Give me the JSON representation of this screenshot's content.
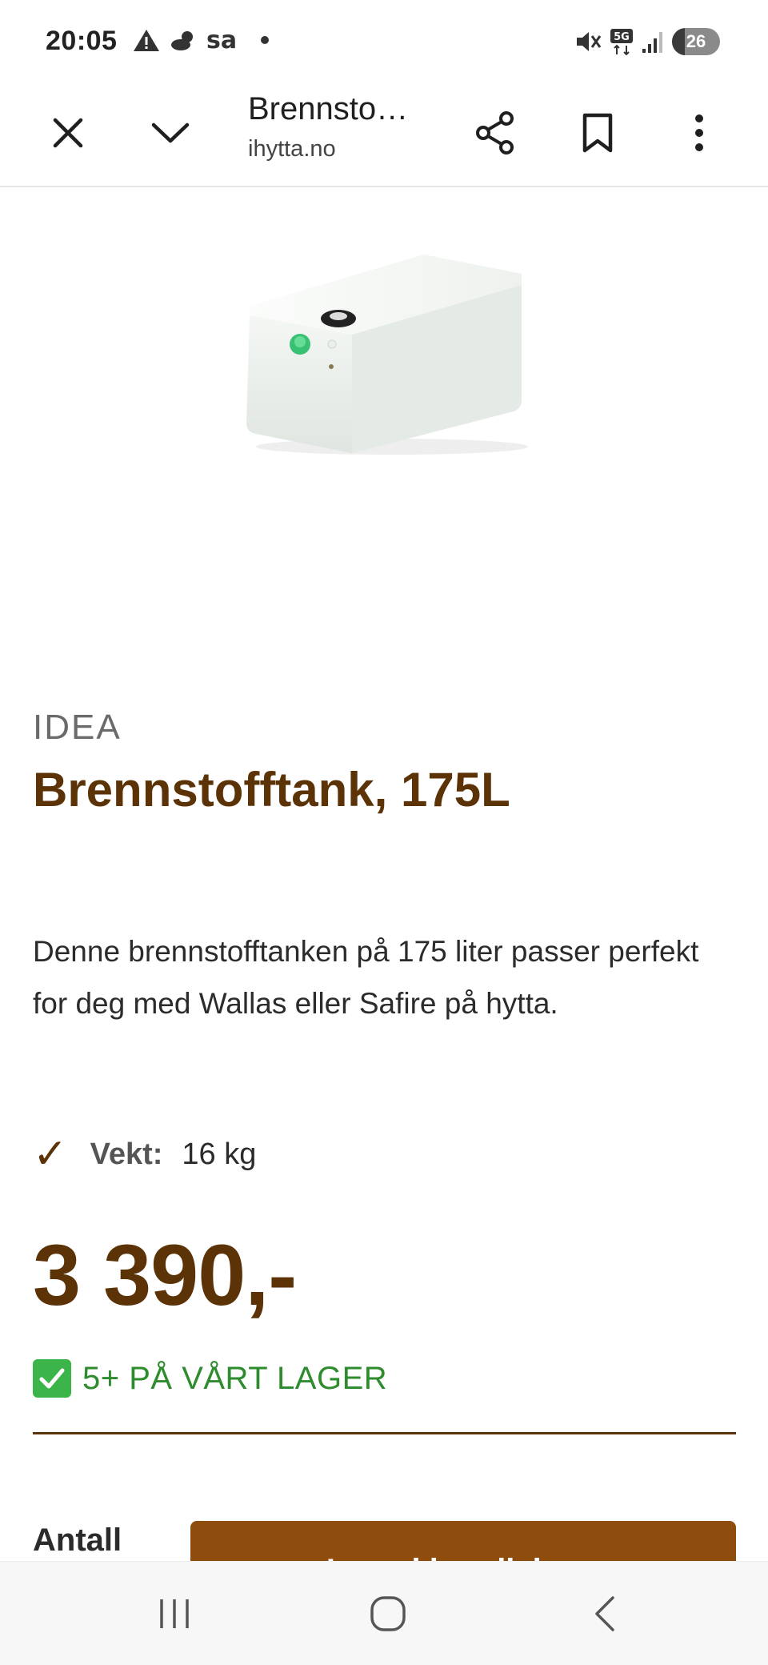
{
  "status_bar": {
    "time": "20:05",
    "weather_label": "sa",
    "network": "5G",
    "battery_level": "26",
    "battery_fraction": 0.26
  },
  "toolbar": {
    "page_title": "Brennsto…",
    "url": "ihytta.no",
    "icons": [
      "close-icon",
      "chevron-down-icon",
      "share-icon",
      "bookmark-icon",
      "more-vert-icon"
    ]
  },
  "product": {
    "brand": "IDEA",
    "title": "Brennstofftank, 175L",
    "description": "Denne brennstofftanken på 175 liter passer perfekt for deg med Wallas eller Safire på hytta.",
    "spec_label": "Vekt:",
    "spec_value": "16 kg",
    "price": "3 390,-",
    "stock": "5+ PÅ VÅRT LAGER",
    "quantity_label": "Antall",
    "buy_label": "Legg i handlekurv"
  },
  "colors": {
    "brand_brown": "#5c3207",
    "button_brown": "#8f4d0d",
    "stock_green": "#2e8b2e"
  },
  "navbar": {
    "icons": [
      "recent-apps-icon",
      "home-icon",
      "back-icon"
    ]
  }
}
